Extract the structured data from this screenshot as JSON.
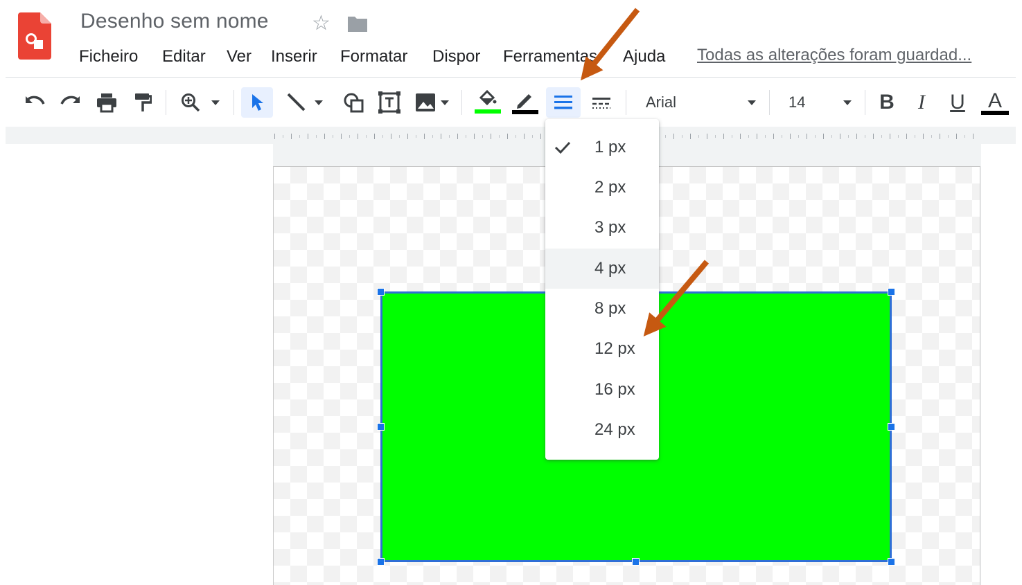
{
  "app": {
    "title": "Desenho sem nome",
    "save_status": "Todas as alterações foram guardad..."
  },
  "menubar": {
    "items": [
      "Ficheiro",
      "Editar",
      "Ver",
      "Inserir",
      "Formatar",
      "Dispor",
      "Ferramentas",
      "Ajuda"
    ]
  },
  "toolbar": {
    "font_name": "Arial",
    "font_size": "14",
    "bold": "B",
    "italic": "I",
    "underline": "U",
    "text_color_letter": "A",
    "fill_color": "#00ff00",
    "border_color": "#000000",
    "text_color": "#000000"
  },
  "border_weight_menu": {
    "selected": "1 px",
    "highlighted": "4 px",
    "options": [
      "1 px",
      "2 px",
      "3 px",
      "4 px",
      "8 px",
      "12 px",
      "16 px",
      "24 px"
    ]
  },
  "shape": {
    "fill_color": "#00ff00",
    "selection_color": "#1a73e8"
  },
  "colors": {
    "accent": "#1a73e8",
    "annotation_arrow": "#c65911",
    "logo": "#ea4335"
  }
}
